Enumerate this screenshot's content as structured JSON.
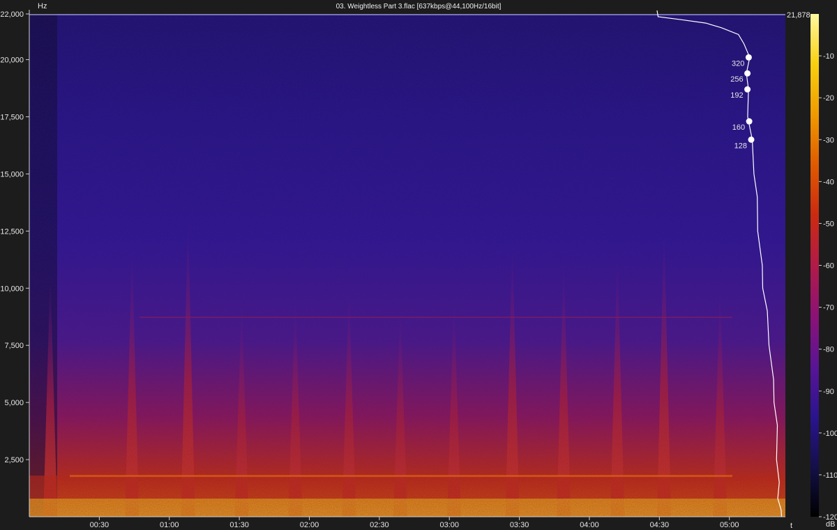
{
  "chart_data": {
    "type": "heatmap",
    "title": "03. Weightless Part 3.flac [637kbps@44,100Hz/16bit]",
    "ylabel": "Hz",
    "xlabel": "t",
    "colorbar_label": "dB",
    "duration_seconds": 324,
    "ylim": [
      0,
      22000
    ],
    "y_ticks": [
      {
        "value": 2500,
        "label": "2,500"
      },
      {
        "value": 5000,
        "label": "5,000"
      },
      {
        "value": 7500,
        "label": "7,500"
      },
      {
        "value": 10000,
        "label": "10,000"
      },
      {
        "value": 12500,
        "label": "12,500"
      },
      {
        "value": 15000,
        "label": "15,000"
      },
      {
        "value": 17500,
        "label": "17,500"
      },
      {
        "value": 20000,
        "label": "20,000"
      },
      {
        "value": 22000,
        "label": "22,000"
      }
    ],
    "x_ticks": [
      {
        "value": 30,
        "label": "00:30"
      },
      {
        "value": 60,
        "label": "01:00"
      },
      {
        "value": 90,
        "label": "01:30"
      },
      {
        "value": 120,
        "label": "02:00"
      },
      {
        "value": 150,
        "label": "02:30"
      },
      {
        "value": 180,
        "label": "03:00"
      },
      {
        "value": 210,
        "label": "03:30"
      },
      {
        "value": 240,
        "label": "04:00"
      },
      {
        "value": 270,
        "label": "04:30"
      },
      {
        "value": 300,
        "label": "05:00"
      }
    ],
    "colorbar": {
      "range": [
        -120,
        0
      ],
      "ticks": [
        {
          "value": -10,
          "label": "-10"
        },
        {
          "value": -20,
          "label": "-20"
        },
        {
          "value": -30,
          "label": "-30"
        },
        {
          "value": -40,
          "label": "-40"
        },
        {
          "value": -50,
          "label": "-50"
        },
        {
          "value": -60,
          "label": "-60"
        },
        {
          "value": -70,
          "label": "-70"
        },
        {
          "value": -80,
          "label": "-80"
        },
        {
          "value": -90,
          "label": "-90"
        },
        {
          "value": -100,
          "label": "-100"
        },
        {
          "value": -110,
          "label": "-110"
        },
        {
          "value": -120,
          "label": "-120"
        }
      ],
      "colors": [
        "#000000",
        "#14104a",
        "#2b1490",
        "#5a1496",
        "#8c1276",
        "#b21a48",
        "#cc2a10",
        "#e05a00",
        "#f09a00",
        "#f8d010",
        "#fff8a0"
      ]
    },
    "cutoff": {
      "value": 21878,
      "label": "21,878"
    },
    "bitrate_markers": [
      {
        "label": "320",
        "freq": 20100
      },
      {
        "label": "256",
        "freq": 19400
      },
      {
        "label": "192",
        "freq": 18700
      },
      {
        "label": "160",
        "freq": 17300
      },
      {
        "label": "128",
        "freq": 16500
      }
    ],
    "spectrum_profile": [
      [
        0,
        0.0
      ],
      [
        300,
        0.02
      ],
      [
        800,
        0.03
      ],
      [
        1500,
        0.035
      ],
      [
        2500,
        0.04
      ],
      [
        4000,
        0.05
      ],
      [
        5000,
        0.06
      ],
      [
        6000,
        0.08
      ],
      [
        7500,
        0.1
      ],
      [
        9000,
        0.13
      ],
      [
        10000,
        0.15
      ],
      [
        11000,
        0.17
      ],
      [
        12500,
        0.19
      ],
      [
        14000,
        0.21
      ],
      [
        15000,
        0.22
      ],
      [
        16500,
        0.25
      ],
      [
        17500,
        0.27
      ],
      [
        18700,
        0.28
      ],
      [
        19400,
        0.28
      ],
      [
        20100,
        0.27
      ],
      [
        20700,
        0.3
      ],
      [
        21100,
        0.36
      ],
      [
        21400,
        0.48
      ],
      [
        21600,
        0.62
      ],
      [
        21750,
        0.8
      ],
      [
        21878,
        1.0
      ]
    ]
  }
}
